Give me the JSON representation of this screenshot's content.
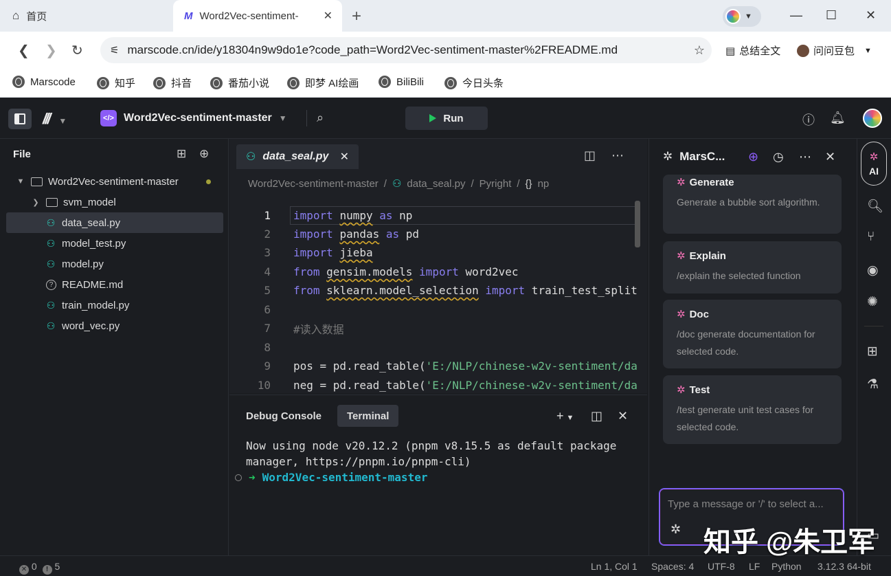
{
  "browser": {
    "tabs": [
      {
        "label": "首页"
      },
      {
        "label": "Word2Vec-sentiment-",
        "close": "✕"
      }
    ],
    "new_tab": "+",
    "window": {
      "minimize": "—",
      "maximize": "☐",
      "close": "✕"
    },
    "url": "marscode.cn/ide/y18304n9w9do1e?code_path=Word2Vec-sentiment-master%2FREADME.md",
    "summarize_label": "总结全文",
    "ask_label": "问问豆包",
    "bookmarks": [
      "Marscode",
      "知乎",
      "抖音",
      "番茄小说",
      "即梦 AI绘画",
      "BiliBili",
      "今日头条"
    ]
  },
  "ide": {
    "project_name": "Word2Vec-sentiment-master",
    "project_icon": "</>",
    "run_label": "Run",
    "explorer": {
      "title": "File",
      "root": "Word2Vec-sentiment-master",
      "items": [
        {
          "name": "svm_model",
          "type": "folder"
        },
        {
          "name": "data_seal.py",
          "type": "py"
        },
        {
          "name": "model_test.py",
          "type": "py"
        },
        {
          "name": "model.py",
          "type": "py"
        },
        {
          "name": "README.md",
          "type": "md"
        },
        {
          "name": "train_model.py",
          "type": "py"
        },
        {
          "name": "word_vec.py",
          "type": "py"
        }
      ]
    },
    "editor": {
      "tab_label": "data_seal.py",
      "breadcrumb": [
        "Word2Vec-sentiment-master",
        "/",
        "data_seal.py",
        "/",
        "Pyright",
        "/",
        "{}",
        "np"
      ],
      "line_numbers": [
        "1",
        "2",
        "3",
        "4",
        "5",
        "6",
        "7",
        "8",
        "9",
        "10"
      ]
    },
    "panel": {
      "tabs": [
        "Debug Console",
        "Terminal"
      ],
      "terminal_output": "Now using node v20.12.2 (pnpm v8.15.5 as default package manager, https://pnpm.io/pnpm-cli)",
      "prompt_arrow": "➜",
      "prompt_dir": "Word2Vec-sentiment-master"
    },
    "ai": {
      "title": "MarsC...",
      "cards": [
        {
          "title": "Generate",
          "desc": "Generate a bubble sort algorithm."
        },
        {
          "title": "Explain",
          "desc": "/explain the selected function"
        },
        {
          "title": "Doc",
          "desc": "/doc generate documentation for selected code."
        },
        {
          "title": "Test",
          "desc": "/test generate unit test cases for selected code."
        }
      ],
      "input_placeholder": "Type a message or '/' to select a..."
    },
    "rail_ai_label": "AI",
    "status": {
      "errors": "0",
      "warnings": "5",
      "position": "Ln 1, Col 1",
      "spaces": "Spaces: 4",
      "encoding": "UTF-8",
      "eol": "LF",
      "language": "Python",
      "interpreter": "3.12.3 64-bit"
    }
  },
  "watermark": "知乎 @朱卫军",
  "colors": {
    "accent": "#8b5cf6",
    "run": "#22c55e",
    "python_icon": "#2dd4bf",
    "keyword": "#8a7ff0",
    "string": "#6cc08b"
  }
}
